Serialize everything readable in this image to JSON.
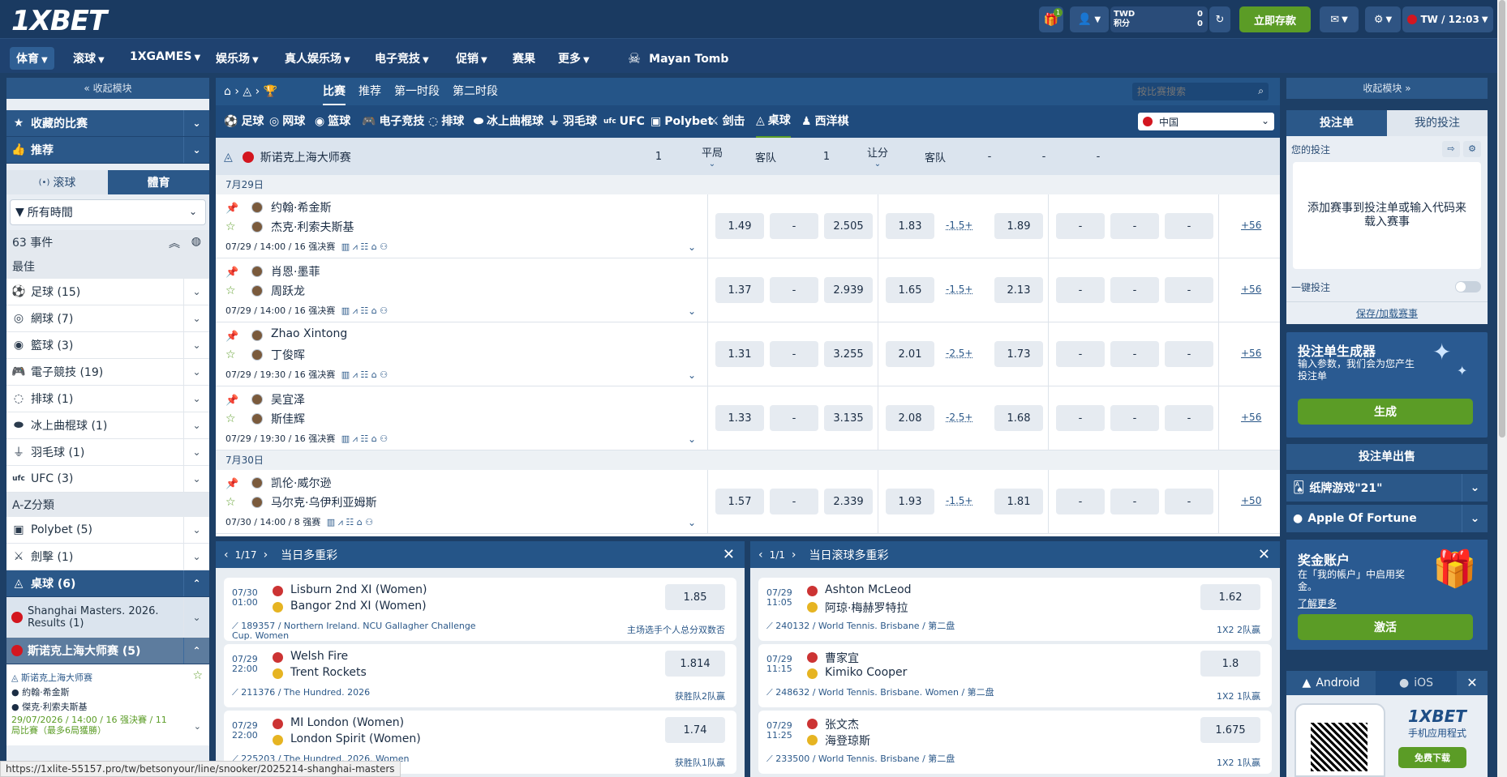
{
  "header": {
    "logo": "1XBET",
    "gift_badge": "1",
    "currency": "TWD",
    "points_label": "积分",
    "balance": "0",
    "points": "0",
    "deposit_label": "立即存款",
    "lang_time": "TW / 12:03",
    "colors": {
      "deposit": "#5b9c26",
      "header": "#1a3a61"
    }
  },
  "nav": {
    "items": [
      "体育",
      "滚球",
      "1XGAMES",
      "娱乐场",
      "真人娱乐场",
      "电子竞技",
      "促销",
      "赛果",
      "更多"
    ],
    "promo": "Mayan Tomb"
  },
  "left": {
    "collapse": "收起模块",
    "fav": "收藏的比赛",
    "recommend": "推荐",
    "live_tab": "滚球",
    "sports_tab": "體育",
    "time_filter": "所有時間",
    "event_count": "63 事件",
    "best": "最佳",
    "sports": [
      "足球 (15)",
      "網球 (7)",
      "籃球 (3)",
      "電子競技 (19)",
      "排球 (1)",
      "冰上曲棍球 (1)",
      "羽毛球 (1)",
      "UFC (3)"
    ],
    "az": "A-Z分類",
    "az_sports": [
      "Polybet (5)",
      "劍擊 (1)"
    ],
    "snooker": "桌球 (6)",
    "shanghai": "Shanghai Masters. 2026. Results (1)",
    "snooker_master": "斯诺克上海大师赛 (5)",
    "mini": {
      "league": "斯诺克上海大师赛",
      "p1": "約翰·希金斯",
      "p2": "傑克·利索夫斯基",
      "info": "29/07/2026 / 14:00 / 16 强決賽 / 11局比賽（最多6局獲勝）"
    }
  },
  "main": {
    "tabs": [
      "比赛",
      "推荐",
      "第一时段",
      "第二时段"
    ],
    "search_placeholder": "按比赛搜索",
    "sports": [
      "足球",
      "网球",
      "篮球",
      "电子竞技",
      "排球",
      "冰上曲棍球",
      "羽毛球",
      "UFC",
      "Polybet",
      "剑击",
      "桌球",
      "西洋棋"
    ],
    "region": "中国",
    "champ": "斯诺克上海大师赛",
    "cols": {
      "c1": "1",
      "draw": "平局",
      "away": "客队",
      "c4": "1",
      "hcp": "让分",
      "away2": "客队",
      "dash": "-"
    },
    "dates": [
      "7月29日",
      "7月30日"
    ],
    "matches": [
      {
        "p1": "约翰·希金斯",
        "p2": "杰克·利索夫斯基",
        "meta": "07/29 / 14:00 / 16 强决赛",
        "o1": "1.49",
        "ox": "-",
        "o2": "2.505",
        "h1": "1.83",
        "hcp": "-1.5+",
        "h2": "1.89",
        "more": "+56"
      },
      {
        "p1": "肖恩·墨菲",
        "p2": "周跃龙",
        "meta": "07/29 / 14:00 / 16 强决赛",
        "o1": "1.37",
        "ox": "-",
        "o2": "2.939",
        "h1": "1.65",
        "hcp": "-1.5+",
        "h2": "2.13",
        "more": "+56"
      },
      {
        "p1": "Zhao Xintong",
        "p2": "丁俊晖",
        "meta": "07/29 / 19:30 / 16 强决赛",
        "o1": "1.31",
        "ox": "-",
        "o2": "3.255",
        "h1": "2.01",
        "hcp": "-2.5+",
        "h2": "1.73",
        "more": "+56"
      },
      {
        "p1": "吴宜泽",
        "p2": "斯佳辉",
        "meta": "07/29 / 19:30 / 16 强决赛",
        "o1": "1.33",
        "ox": "-",
        "o2": "3.135",
        "h1": "2.08",
        "hcp": "-2.5+",
        "h2": "1.68",
        "more": "+56"
      },
      {
        "p1": "凯伦·威尔逊",
        "p2": "马尔克·乌伊利亚姆斯",
        "meta": "07/30 / 14:00 / 8 强赛",
        "o1": "1.57",
        "ox": "-",
        "o2": "2.339",
        "h1": "1.93",
        "hcp": "-1.5+",
        "h2": "1.81",
        "more": "+50"
      }
    ]
  },
  "acca_day": {
    "pager": "1/17",
    "title": "当日多重彩",
    "cards": [
      {
        "date": "07/30",
        "time": "01:00",
        "t1": "Lisburn 2nd XI (Women)",
        "t2": "Bangor 2nd XI (Women)",
        "odd": "1.85",
        "league": "189357 / Northern Ireland. NCU Gallagher Challenge Cup. Women",
        "bet": "主场选手个人总分双数否"
      },
      {
        "date": "07/29",
        "time": "22:00",
        "t1": "Welsh Fire",
        "t2": "Trent Rockets",
        "odd": "1.814",
        "league": "211376 / The Hundred. 2026",
        "bet": "获胜队2队赢"
      },
      {
        "date": "07/29",
        "time": "22:00",
        "t1": "MI London (Women)",
        "t2": "London Spirit (Women)",
        "odd": "1.74",
        "league": "225203 / The Hundred. 2026. Women",
        "bet": "获胜队1队赢"
      }
    ]
  },
  "acca_live": {
    "pager": "1/1",
    "title": "当日滚球多重彩",
    "cards": [
      {
        "date": "07/29",
        "time": "11:05",
        "t1": "Ashton McLeod",
        "t2": "阿琼·梅赫罗特拉",
        "odd": "1.62",
        "league": "240132 / World Tennis. Brisbane / 第二盘",
        "bet": "1X2 2队赢"
      },
      {
        "date": "07/29",
        "time": "11:15",
        "t1": "曹家宜",
        "t2": "Kimiko Cooper",
        "odd": "1.8",
        "league": "248632 / World Tennis. Brisbane. Women / 第二盘",
        "bet": "1X2 1队赢"
      },
      {
        "date": "07/29",
        "time": "11:25",
        "t1": "张文杰",
        "t2": "海登琼斯",
        "odd": "1.675",
        "league": "233500 / World Tennis. Brisbane / 第二盘",
        "bet": "1X2 1队赢"
      }
    ]
  },
  "right": {
    "collapse": "收起模块",
    "slip_tab": "投注单",
    "mybets_tab": "我的投注",
    "your_bets": "您的投注",
    "empty_msg": "添加赛事到投注单或输入代码来载入赛事",
    "one_click": "一键投注",
    "save_load": "保存/加载赛事",
    "gen_title": "投注单生成器",
    "gen_desc": "输入参数，我们会为您产生投注单",
    "gen_btn": "生成",
    "sale": "投注单出售",
    "game1": "纸牌游戏\"21\"",
    "game2": "Apple Of Fortune",
    "bonus_title": "奖金账户",
    "bonus_desc": "在「我的帳户」中启用奖金。",
    "learn_more": "了解更多",
    "activate": "激活",
    "android": "Android",
    "ios": "iOS",
    "app_brand": "1XBET",
    "app_label": "手机应用程式",
    "download": "免费下载"
  },
  "status_url": "https://1xlite-55157.pro/tw/betsonyour/line/snooker/2025214-shanghai-masters"
}
